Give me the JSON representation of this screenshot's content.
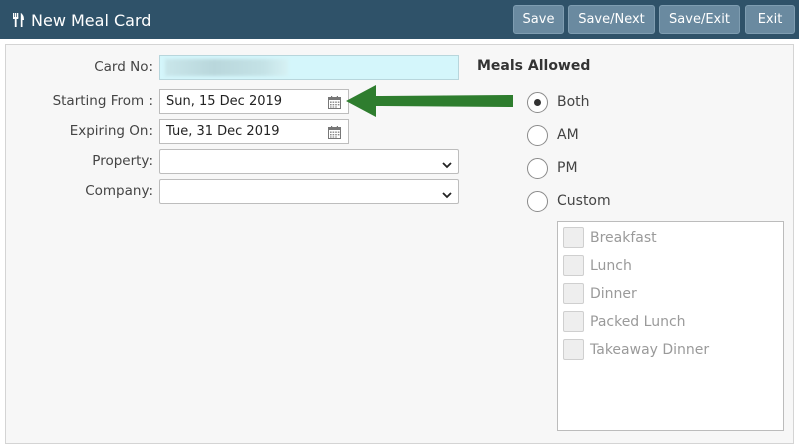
{
  "header": {
    "title": "New Meal Card",
    "buttons": {
      "save": "Save",
      "save_next": "Save/Next",
      "save_exit": "Save/Exit",
      "exit": "Exit"
    }
  },
  "form": {
    "card_no_label": "Card No:",
    "card_no_value": "",
    "starting_from_label": "Starting From :",
    "starting_from_value": "Sun, 15 Dec 2019",
    "expiring_on_label": "Expiring On:",
    "expiring_on_value": "Tue, 31 Dec 2019",
    "property_label": "Property:",
    "property_value": "",
    "company_label": "Company:",
    "company_value": ""
  },
  "meals": {
    "title": "Meals Allowed",
    "options": [
      {
        "label": "Both",
        "selected": true
      },
      {
        "label": "AM",
        "selected": false
      },
      {
        "label": "PM",
        "selected": false
      },
      {
        "label": "Custom",
        "selected": false
      }
    ],
    "custom_items": [
      "Breakfast",
      "Lunch",
      "Dinner",
      "Packed Lunch",
      "Takeaway Dinner"
    ]
  },
  "colors": {
    "header_bg": "#2f5269",
    "button_bg": "#6a8aa0",
    "card_field_bg": "#d4f6fb",
    "arrow": "#2e7d2e"
  },
  "icons": [
    "utensils-icon",
    "calendar-icon",
    "chevron-down-icon"
  ]
}
